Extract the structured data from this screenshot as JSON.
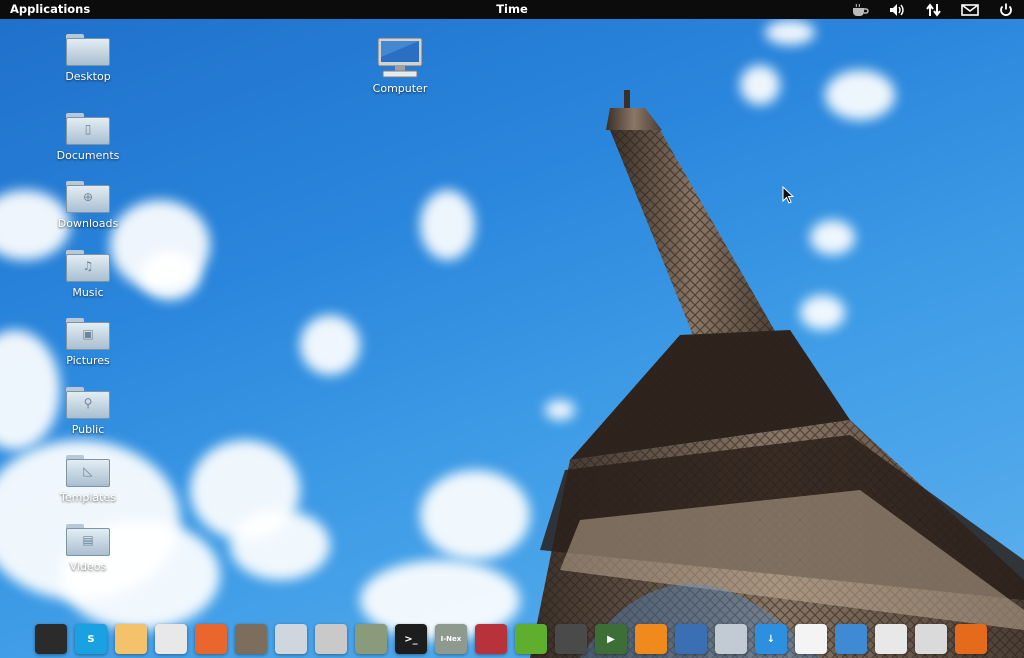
{
  "panel": {
    "applications_label": "Applications",
    "clock_label": "Time",
    "indicators": [
      "coffee-icon",
      "volume-icon",
      "network-icon",
      "mail-icon",
      "power-icon"
    ]
  },
  "desktop": {
    "icons": [
      {
        "label": "Desktop",
        "icon": "folder-icon"
      },
      {
        "label": "Documents",
        "icon": "folder-documents-icon"
      },
      {
        "label": "Downloads",
        "icon": "folder-downloads-icon"
      },
      {
        "label": "Music",
        "icon": "folder-music-icon"
      },
      {
        "label": "Pictures",
        "icon": "folder-pictures-icon"
      },
      {
        "label": "Public",
        "icon": "folder-public-icon"
      },
      {
        "label": "Templates",
        "icon": "folder-templates-icon"
      },
      {
        "label": "Videos",
        "icon": "folder-videos-icon"
      }
    ],
    "computer_label": "Computer"
  },
  "dock": {
    "items": [
      {
        "name": "system-monitor-icon",
        "color": "#2b2b2b",
        "text": ""
      },
      {
        "name": "skype-icon",
        "color": "#1aa1e1",
        "text": "S"
      },
      {
        "name": "mail-client-icon",
        "color": "#f3c26a",
        "text": ""
      },
      {
        "name": "calendar-icon",
        "color": "#e8e8e8",
        "text": ""
      },
      {
        "name": "photo-manager-icon",
        "color": "#e9662c",
        "text": ""
      },
      {
        "name": "gimp-icon",
        "color": "#7d6d5c",
        "text": ""
      },
      {
        "name": "workspace-switcher-icon",
        "color": "#cfd6dd",
        "text": ""
      },
      {
        "name": "disk-icon",
        "color": "#c9c9c9",
        "text": ""
      },
      {
        "name": "disk-usage-icon",
        "color": "#8a9a7a",
        "text": ""
      },
      {
        "name": "terminal-icon",
        "color": "#1d1d1d",
        "text": ">_"
      },
      {
        "name": "i-nex-icon",
        "color": "#8d9a8d",
        "text": "I-Nex"
      },
      {
        "name": "package-installer-icon",
        "color": "#b8323c",
        "text": ""
      },
      {
        "name": "nvidia-settings-icon",
        "color": "#5fae2d",
        "text": ""
      },
      {
        "name": "calculator-icon",
        "color": "#4a4a4a",
        "text": ""
      },
      {
        "name": "media-player-icon",
        "color": "#3e6e38",
        "text": "▶"
      },
      {
        "name": "vlc-icon",
        "color": "#f08a1c",
        "text": ""
      },
      {
        "name": "backup-icon",
        "color": "#3a6fb4",
        "text": ""
      },
      {
        "name": "home-folder-icon",
        "color": "#c2cbd3",
        "text": ""
      },
      {
        "name": "download-manager-icon",
        "color": "#2c8fe0",
        "text": "↓"
      },
      {
        "name": "text-document-icon",
        "color": "#f4f4f4",
        "text": ""
      },
      {
        "name": "screen-settings-icon",
        "color": "#3f8ad4",
        "text": ""
      },
      {
        "name": "chrome-icon",
        "color": "#e8e8e8",
        "text": ""
      },
      {
        "name": "disc-burner-icon",
        "color": "#dadada",
        "text": ""
      },
      {
        "name": "firefox-icon",
        "color": "#e66a1c",
        "text": ""
      }
    ]
  }
}
